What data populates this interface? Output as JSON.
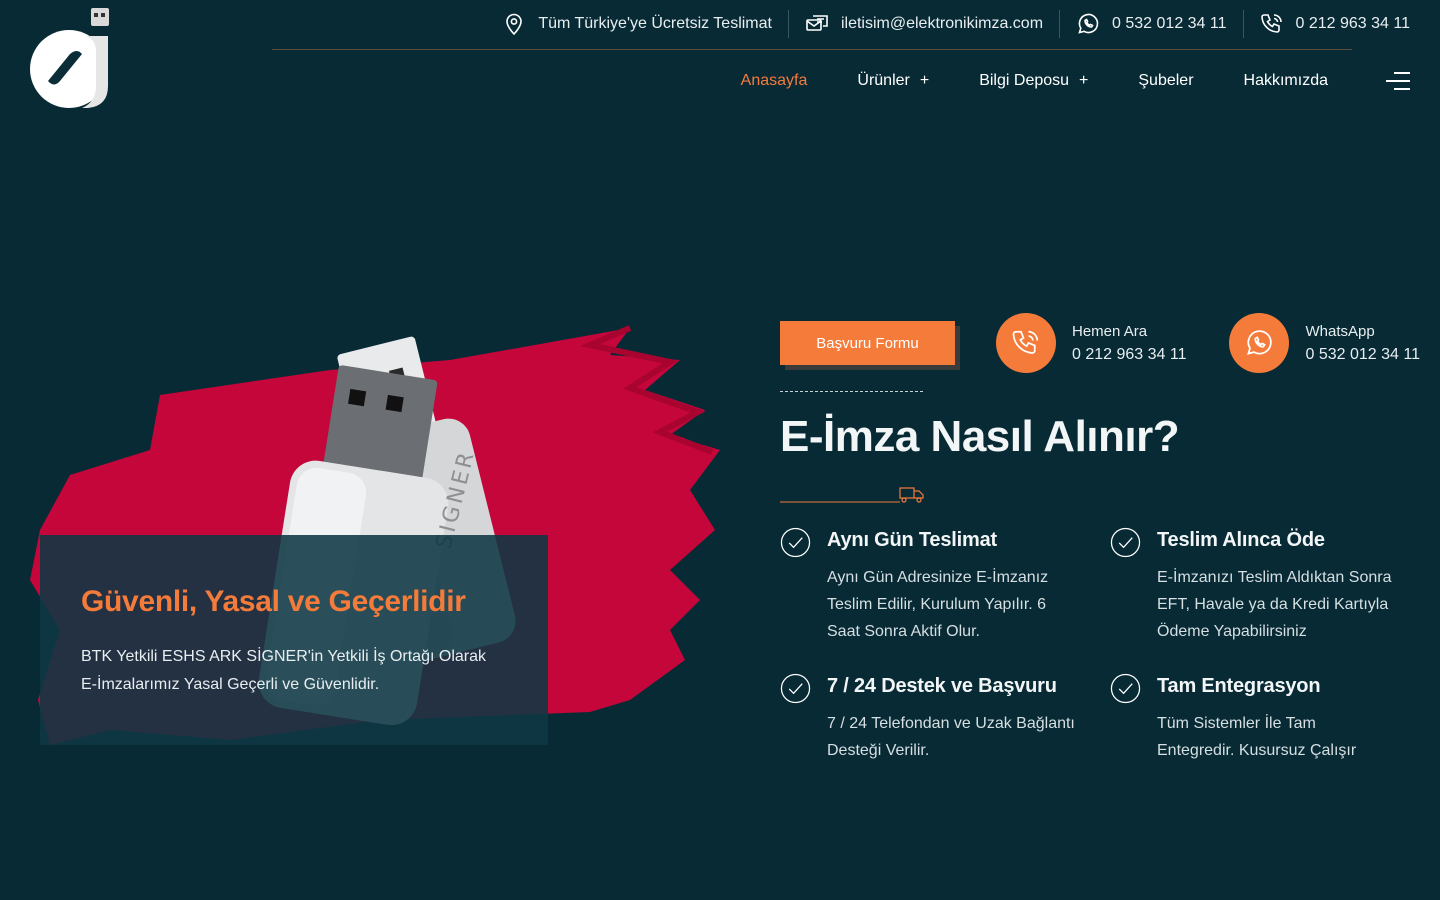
{
  "topbar": {
    "shipping": "Tüm Türkiye'ye Ücretsiz Teslimat",
    "email": "iletisim@elektronikimza.com",
    "whatsapp": "0 532 012 34 11",
    "phone": "0 212 963 34 11"
  },
  "nav": {
    "items": [
      {
        "label": "Anasayfa",
        "active": true
      },
      {
        "label": "Ürünler",
        "has_submenu": true
      },
      {
        "label": "Bilgi Deposu",
        "has_submenu": true
      },
      {
        "label": "Şubeler"
      },
      {
        "label": "Hakkımızda"
      }
    ],
    "plus": "+"
  },
  "hero": {
    "heading": "Güvenli, Yasal ve Geçerlidir",
    "text": "BTK Yetkili ESHS ARK SİGNER'in Yetkili İş Ortağı Olarak E-İmzalarımız Yasal Geçerli ve Güvenlidir.",
    "token_brand": "SIGNER"
  },
  "cta": {
    "apply_button": "Başvuru Formu",
    "call_label": "Hemen Ara",
    "call_number": "0 212 963 34 11",
    "whatsapp_label": "WhatsApp",
    "whatsapp_number": "0 532 012 34 11"
  },
  "section": {
    "title": "E-İmza Nasıl Alınır?"
  },
  "features": [
    {
      "title": "Aynı Gün Teslimat",
      "text": "Aynı Gün Adresinize E-İmzanız Teslim Edilir, Kurulum Yapılır. 6 Saat Sonra Aktif Olur."
    },
    {
      "title": "Teslim Alınca Öde",
      "text": "E-İmzanızı Teslim Aldıktan Sonra EFT, Havale ya da Kredi Kartıyla Ödeme Yapabilirsiniz"
    },
    {
      "title": "7 / 24 Destek ve Başvuru",
      "text": "7 / 24 Telefondan ve Uzak Bağlantı Desteği Verilir."
    },
    {
      "title": "Tam Entegrasyon",
      "text": "Tüm Sistemler İle Tam Entegredir. Kusursuz Çalışır"
    }
  ],
  "colors": {
    "background": "#082a35",
    "accent": "#f47b3a",
    "brush": "#c4063a"
  }
}
